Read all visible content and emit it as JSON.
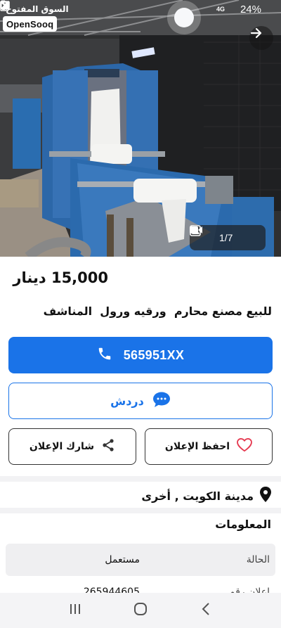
{
  "status_bar": {
    "brand_ar": "السوق المفتوح",
    "signal_label": "4G",
    "battery": "24%"
  },
  "logo": {
    "text": "OpenSooq"
  },
  "gallery": {
    "counter": "1/7",
    "icons": [
      "video-icon",
      "image-icon",
      "arrow-right-icon"
    ]
  },
  "listing": {
    "price": "15,000 دينار",
    "title": "للبيع مصنع محارم  ورقيه ورول  المناشف"
  },
  "actions": {
    "call_label": "565951XX",
    "chat_label": "دردش",
    "save_label": "احفظ الإعلان",
    "share_label": "شارك الإعلان"
  },
  "location": {
    "text": "مدينة الكويت , أخرى"
  },
  "info": {
    "section_title": "المعلومات",
    "rows": [
      {
        "key": "الحالة",
        "value": "مستعمل"
      },
      {
        "key": "اعلان رقم",
        "value": "265944605"
      }
    ]
  },
  "colors": {
    "primary": "#1a73e8",
    "heart": "#e53950",
    "divider": "#f2f2f4",
    "row_shade": "#efeff1"
  }
}
